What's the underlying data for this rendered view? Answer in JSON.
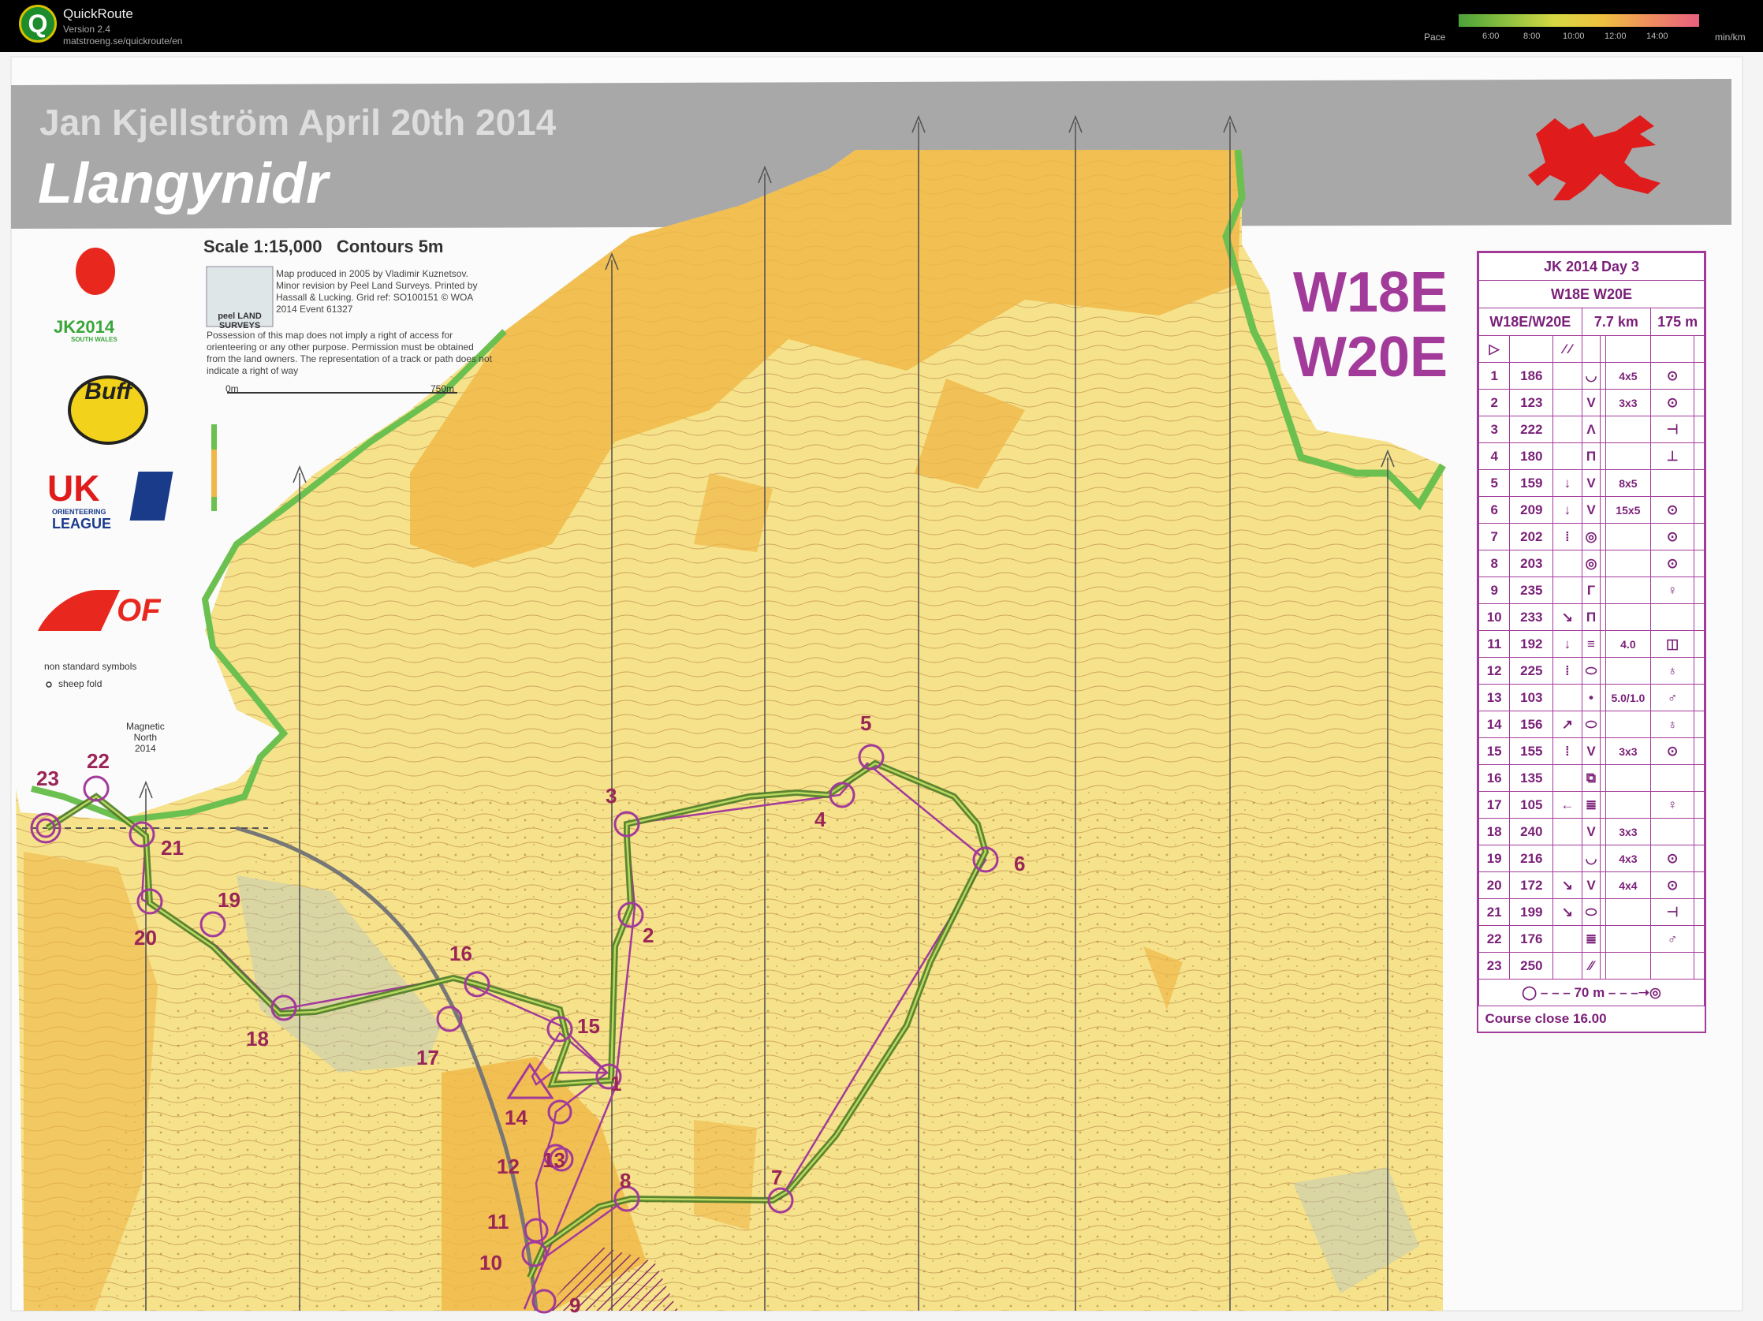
{
  "app": {
    "name": "QuickRoute",
    "version": "Version 2.4",
    "url": "matstroeng.se/quickroute/en"
  },
  "pace_scale": {
    "label": "Pace",
    "ticks": [
      "6:00",
      "8:00",
      "10:00",
      "12:00",
      "14:00"
    ],
    "unit": "min/km"
  },
  "map": {
    "title": "Jan Kjellström April 20th 2014",
    "location": "Llangynidr",
    "scale": "Scale 1:15,000",
    "contours": "Contours 5m",
    "credits": "Map produced in 2005 by Vladimir Kuznetsov. Minor revision by Peel Land Surveys. Printed by Hassall & Lucking. Grid ref: SO100151 © WOA 2014 Event 61327",
    "publisher_logo": "peel LAND SURVEYS",
    "disclaimer": "Possession of this map does not imply a right of access for orienteering or any other purpose. Permission must be obtained from the land owners. The representation of a track or path does not indicate a right of way",
    "scalebar_start": "0m",
    "scalebar_end": "750m",
    "non_standard": "non standard symbols",
    "sheep_fold": "sheep fold",
    "magnetic_north": [
      "Magnetic",
      "North",
      "2014"
    ],
    "course_line1": "W18E",
    "course_line2": "W20E",
    "sponsors": [
      "JK2014 SOUTH WALES",
      "Buff",
      "UK ORIENTEERING LEAGUE",
      "IOF"
    ],
    "jk_logo_text": "JK2014",
    "jk_logo_sub": "SOUTH WALES",
    "buff_text": "Buff",
    "uk_text": "UK",
    "uk_sub1": "ORIENTEERING",
    "uk_sub2": "LEAGUE",
    "iof_text": "OF"
  },
  "control_description": {
    "event": "JK 2014 Day 3",
    "classes": "W18E W20E",
    "class_col": "W18E/W20E",
    "length": "7.7 km",
    "climb": "175 m",
    "controls": [
      {
        "n": "1",
        "code": "186",
        "detail": "4x5"
      },
      {
        "n": "2",
        "code": "123",
        "detail": "3x3"
      },
      {
        "n": "3",
        "code": "222",
        "detail": ""
      },
      {
        "n": "4",
        "code": "180",
        "detail": ""
      },
      {
        "n": "5",
        "code": "159",
        "detail": "8x5"
      },
      {
        "n": "6",
        "code": "209",
        "detail": "15x5"
      },
      {
        "n": "7",
        "code": "202",
        "detail": ""
      },
      {
        "n": "8",
        "code": "203",
        "detail": ""
      },
      {
        "n": "9",
        "code": "235",
        "detail": ""
      },
      {
        "n": "10",
        "code": "233",
        "detail": ""
      },
      {
        "n": "11",
        "code": "192",
        "detail": "4.0"
      },
      {
        "n": "12",
        "code": "225",
        "detail": ""
      },
      {
        "n": "13",
        "code": "103",
        "detail": "5.0/1.0"
      },
      {
        "n": "14",
        "code": "156",
        "detail": ""
      },
      {
        "n": "15",
        "code": "155",
        "detail": "3x3"
      },
      {
        "n": "16",
        "code": "135",
        "detail": ""
      },
      {
        "n": "17",
        "code": "105",
        "detail": ""
      },
      {
        "n": "18",
        "code": "240",
        "detail": "3x3"
      },
      {
        "n": "19",
        "code": "216",
        "detail": "4x3"
      },
      {
        "n": "20",
        "code": "172",
        "detail": "4x4"
      },
      {
        "n": "21",
        "code": "199",
        "detail": ""
      },
      {
        "n": "22",
        "code": "176",
        "detail": ""
      },
      {
        "n": "23",
        "code": "250",
        "detail": ""
      }
    ],
    "finish_distance": "70 m",
    "course_close": "Course close 16.00"
  },
  "control_labels": [
    "1",
    "2",
    "3",
    "4",
    "5",
    "6",
    "7",
    "8",
    "9",
    "10",
    "11",
    "12",
    "13",
    "14",
    "15",
    "16",
    "17",
    "18",
    "19",
    "20",
    "21",
    "22",
    "23"
  ],
  "colors": {
    "course": "#a23a9a",
    "route": "#6a9a2a",
    "open_land": "#f5e28a",
    "rough_open": "#f0b848",
    "boundary": "#6cc050"
  }
}
